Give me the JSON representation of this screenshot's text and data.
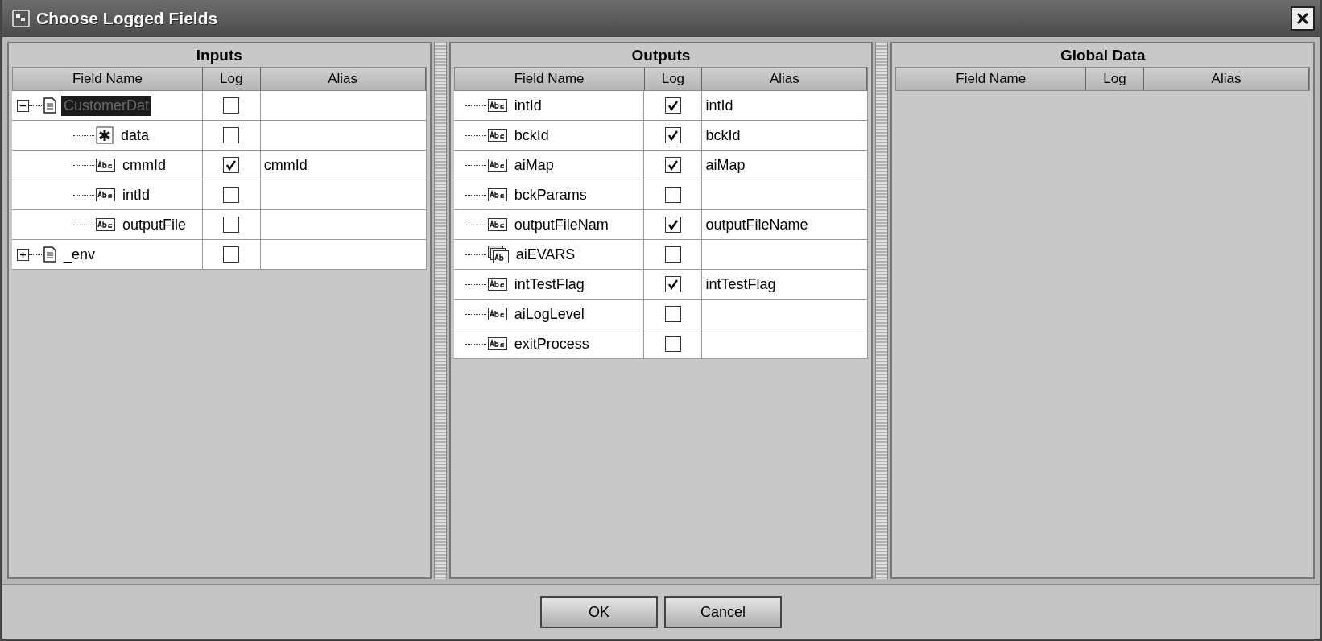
{
  "window": {
    "title": "Choose Logged Fields"
  },
  "panels": [
    {
      "title": "Inputs",
      "columns": [
        "Field Name",
        "Log",
        "Alias"
      ],
      "rows": [
        {
          "name": "CustomerDat",
          "kind": "doc",
          "log": false,
          "selected": true,
          "expanded": true,
          "children": [
            {
              "name": "data",
              "kind": "star",
              "log": false,
              "selected": false
            },
            {
              "name": "cmmId",
              "kind": "abc",
              "log": true,
              "alias": "cmmId",
              "selected": false
            },
            {
              "name": "intId",
              "kind": "abc",
              "log": false,
              "selected": false
            },
            {
              "name": "outputFile",
              "kind": "abc",
              "log": false,
              "selected": false
            }
          ]
        },
        {
          "name": "_env",
          "kind": "doc",
          "log": false,
          "selected": false,
          "expanded": false
        }
      ]
    },
    {
      "title": "Outputs",
      "columns": [
        "Field Name",
        "Log",
        "Alias"
      ],
      "rows": [
        {
          "name": "intId",
          "kind": "abc",
          "log": true,
          "alias": "intId",
          "selected": false
        },
        {
          "name": "bckId",
          "kind": "abc",
          "log": true,
          "alias": "bckId",
          "selected": false
        },
        {
          "name": "aiMap",
          "kind": "abc",
          "log": true,
          "alias": "aiMap",
          "selected": false
        },
        {
          "name": "bckParams",
          "kind": "abc",
          "log": false,
          "selected": false
        },
        {
          "name": "outputFileNam",
          "kind": "abc",
          "log": true,
          "alias": "outputFileName",
          "selected": false
        },
        {
          "name": "aiEVARS",
          "kind": "array",
          "log": false,
          "selected": false
        },
        {
          "name": "intTestFlag",
          "kind": "abc",
          "log": true,
          "alias": "intTestFlag",
          "selected": false
        },
        {
          "name": "aiLogLevel",
          "kind": "abc",
          "log": false,
          "selected": false
        },
        {
          "name": "exitProcess",
          "kind": "abc",
          "log": false,
          "selected": false
        }
      ]
    },
    {
      "title": "Global Data",
      "columns": [
        "Field Name",
        "Log",
        "Alias"
      ]
    }
  ],
  "buttons": [
    "OK",
    "Cancel"
  ]
}
